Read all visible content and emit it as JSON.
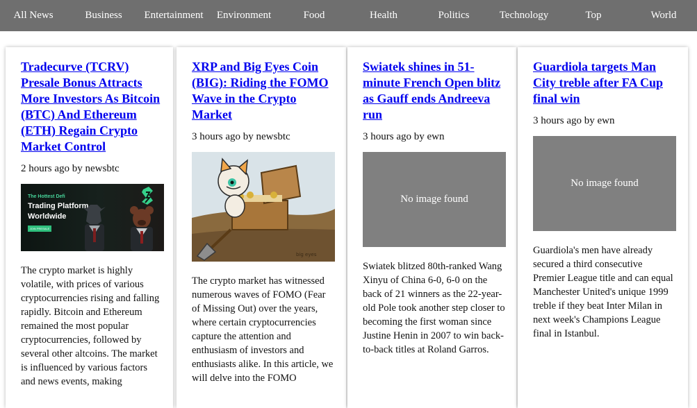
{
  "nav": {
    "items": [
      "All News",
      "Business",
      "Entertainment",
      "Environment",
      "Food",
      "Health",
      "Politics",
      "Technology",
      "Top",
      "World"
    ]
  },
  "articles": [
    {
      "title": "Tradecurve (TCRV) Presale Bonus Attracts More Investors As Bitcoin (BTC) And Ethereum (ETH) Regain Crypto Market Control",
      "meta": "2 hours ago by newsbtc",
      "image": {
        "kind": "promo",
        "promo_tag": "The Hottest Defi",
        "promo_title": "Trading Platform Worldwide",
        "promo_button": "JOIN PRESALE"
      },
      "summary": "The crypto market is highly volatile, with prices of various cryptocurrencies rising and falling rapidly. Bitcoin and Ethereum remained the most popular cryptocurrencies, followed by several other altcoins. The market is influenced by various factors and news events, making"
    },
    {
      "title": "XRP and Big Eyes Coin (BIG): Riding the FOMO Wave in the Crypto Market",
      "meta": "3 hours ago by newsbtc",
      "image": {
        "kind": "cartoon",
        "signature": "big eyes"
      },
      "summary": "The crypto market has witnessed numerous waves of FOMO (Fear of Missing Out) over the years, where certain cryptocurrencies capture the attention and enthusiasm of investors and enthusiasts alike. In this article, we will delve into the FOMO"
    },
    {
      "title": "Swiatek shines in 51-minute French Open blitz as Gauff ends Andreeva run",
      "meta": "3 hours ago by ewn",
      "image": {
        "kind": "placeholder",
        "text": "No image found"
      },
      "summary": "Swiatek blitzed 80th-ranked Wang Xinyu of China 6-0, 6-0 on the back of 21 winners as the 22-year-old Pole took another step closer to becoming the first woman since Justine Henin in 2007 to win back-to-back titles at Roland Garros."
    },
    {
      "title": "Guardiola targets Man City treble after FA Cup final win",
      "meta": "3 hours ago by ewn",
      "image": {
        "kind": "placeholder",
        "text": "No image found"
      },
      "summary": "Guardiola's men have already secured a third consecutive Premier League title and can equal Manchester United's unique 1999 treble if they beat Inter Milan in next week's Champions League final in Istanbul."
    }
  ],
  "colors": {
    "navbar_bg": "#6f6f6f",
    "link": "#0000ee",
    "placeholder_bg": "#808080"
  }
}
